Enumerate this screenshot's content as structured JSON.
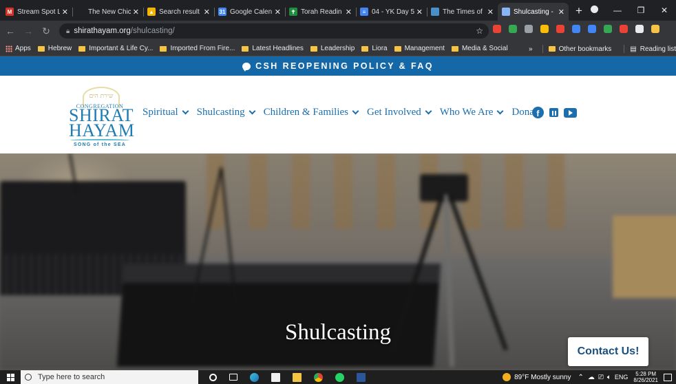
{
  "browser": {
    "tabs": [
      {
        "title": "Stream Spot L",
        "favicon_color": "#d93025",
        "favicon": "M",
        "active": false
      },
      {
        "title": "The New Chic",
        "favicon_color": "#202124",
        "favicon": "",
        "active": false
      },
      {
        "title": "Search result",
        "favicon_color": "#f4b400",
        "favicon": "▲",
        "active": false
      },
      {
        "title": "Google Calen",
        "favicon_color": "#4285f4",
        "favicon": "31",
        "active": false
      },
      {
        "title": "Torah Readin",
        "favicon_color": "#1e8e3e",
        "favicon": "✝",
        "active": false
      },
      {
        "title": "04 - YK Day 5",
        "favicon_color": "#4285f4",
        "favicon": "≡",
        "active": false
      },
      {
        "title": "The Times of",
        "favicon_color": "#4a90c8",
        "favicon": "",
        "active": false
      },
      {
        "title": "Shulcasting -",
        "favicon_color": "#8ab4f8",
        "favicon": "",
        "active": true
      }
    ],
    "tab_close": "✕",
    "new_tab": "+",
    "window_controls": {
      "minimize": "—",
      "restore": "❐",
      "close": "✕"
    },
    "url_host": "shirathayam.org",
    "url_path": "/shulcasting/",
    "extension_colors": [
      "#ea4335",
      "#34a853",
      "#9aa0a6",
      "#fbbc04",
      "#ea4335",
      "#4285f4",
      "#4285f4",
      "#34a853",
      "#ea4335",
      "#e8eaed",
      "#f6c445"
    ],
    "bookmarks": [
      "Hebrew",
      "Important & Life Cy...",
      "Imported From Fire...",
      "Latest Headlines",
      "Leadership",
      "Liora",
      "Management",
      "Media & Social"
    ],
    "apps_label": "Apps",
    "overflow": "»",
    "other_bookmarks": "Other bookmarks",
    "reading_list": "Reading list"
  },
  "banner": {
    "text": "CSH REOPENING POLICY & FAQ"
  },
  "logo": {
    "hebrew": "שירת הים",
    "congregation": "CONGREGATION",
    "shirat": "SHIRAT",
    "hayam": "HAYAM",
    "tagline": "SONG of the SEA"
  },
  "nav": [
    {
      "label": "Spiritual"
    },
    {
      "label": "Shulcasting"
    },
    {
      "label": "Children & Families"
    },
    {
      "label": "Get Involved"
    },
    {
      "label": "Who We Are"
    }
  ],
  "nav_last": "Dona",
  "hero": {
    "title": "Shulcasting"
  },
  "contact_button": "Contact Us!",
  "taskbar": {
    "search_placeholder": "Type here to search",
    "weather": "89°F  Mostly sunny",
    "language": "ENG",
    "time": "5:28 PM",
    "date": "8/26/2021"
  }
}
